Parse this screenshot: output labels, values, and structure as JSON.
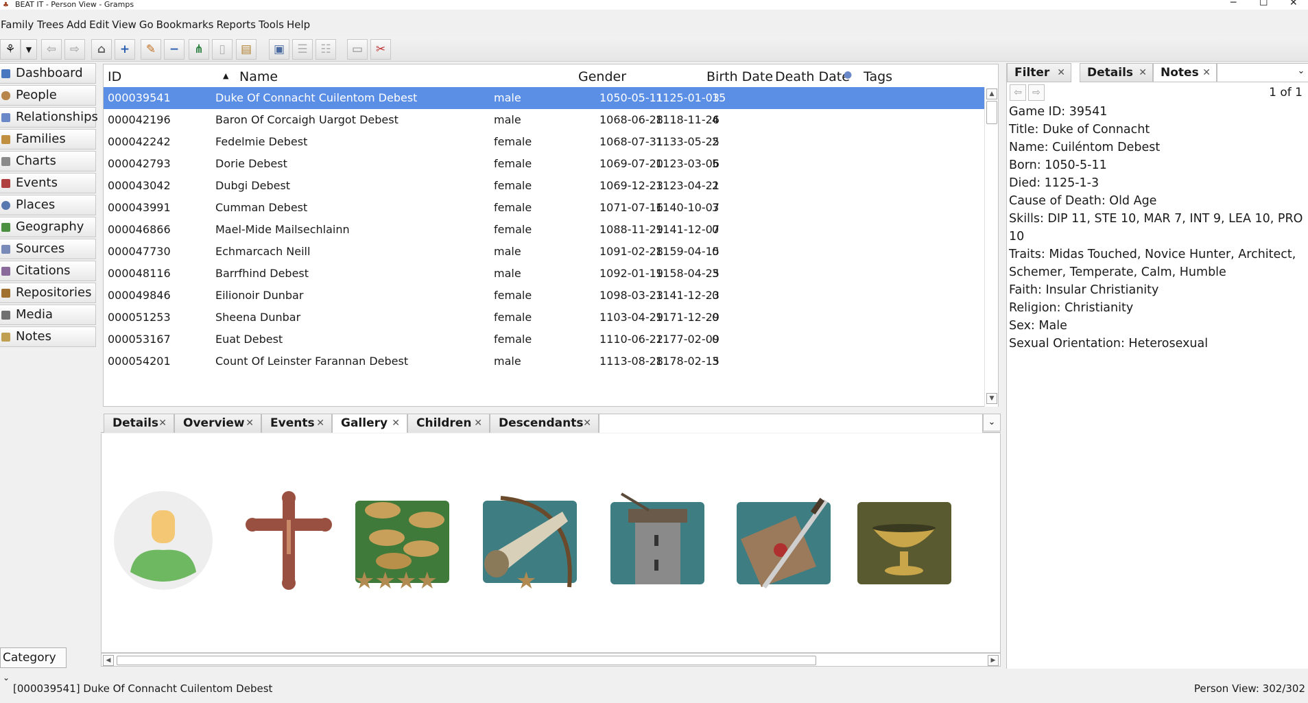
{
  "window": {
    "title": "BEAT IT - Person View - Gramps"
  },
  "menu": [
    "Family Trees",
    "Add",
    "Edit",
    "View",
    "Go",
    "Bookmarks",
    "Reports",
    "Tools",
    "Help"
  ],
  "sidebar": {
    "items": [
      {
        "label": "Dashboard",
        "icon": "dashboard-icon",
        "color": "#4a78c0"
      },
      {
        "label": "People",
        "icon": "people-icon",
        "color": "#b8864a"
      },
      {
        "label": "Relationships",
        "icon": "relationships-icon",
        "color": "#6a88c8"
      },
      {
        "label": "Families",
        "icon": "families-icon",
        "color": "#c09040"
      },
      {
        "label": "Charts",
        "icon": "charts-icon",
        "color": "#8a8a8a"
      },
      {
        "label": "Events",
        "icon": "events-icon",
        "color": "#b04040"
      },
      {
        "label": "Places",
        "icon": "places-icon",
        "color": "#5878b0"
      },
      {
        "label": "Geography",
        "icon": "geography-icon",
        "color": "#4a9040"
      },
      {
        "label": "Sources",
        "icon": "sources-icon",
        "color": "#7a8ab8"
      },
      {
        "label": "Citations",
        "icon": "citations-icon",
        "color": "#8a6a9a"
      },
      {
        "label": "Repositories",
        "icon": "repositories-icon",
        "color": "#a07030"
      },
      {
        "label": "Media",
        "icon": "media-icon",
        "color": "#707070"
      },
      {
        "label": "Notes",
        "icon": "notes-icon",
        "color": "#c0a050"
      }
    ],
    "category_label": "Category"
  },
  "list": {
    "headers": {
      "id": "ID",
      "name": "Name",
      "gender": "Gender",
      "birth": "Birth Date",
      "death": "Death Date",
      "tags": "Tags"
    },
    "rows": [
      {
        "id": "000039541",
        "name": "Duke Of Connacht Cuilentom Debest",
        "gender": "male",
        "birth": "1050-05-11",
        "death": "1125-01-03",
        "count": "15",
        "selected": true
      },
      {
        "id": "000042196",
        "name": "Baron Of Corcaigh Uargot Debest",
        "gender": "male",
        "birth": "1068-06-28",
        "death": "1118-11-26",
        "count": "4"
      },
      {
        "id": "000042242",
        "name": "Fedelmie Debest",
        "gender": "female",
        "birth": "1068-07-31",
        "death": "1133-05-25",
        "count": "2"
      },
      {
        "id": "000042793",
        "name": "Dorie Debest",
        "gender": "female",
        "birth": "1069-07-20",
        "death": "1123-03-06",
        "count": "5"
      },
      {
        "id": "000043042",
        "name": "Dubgi Debest",
        "gender": "female",
        "birth": "1069-12-23",
        "death": "1123-04-21",
        "count": "2"
      },
      {
        "id": "000043991",
        "name": "Cumman Debest",
        "gender": "female",
        "birth": "1071-07-16",
        "death": "1140-10-07",
        "count": "3"
      },
      {
        "id": "000046866",
        "name": "Mael-Mide Mailsechlainn",
        "gender": "female",
        "birth": "1088-11-29",
        "death": "1141-12-07",
        "count": "0"
      },
      {
        "id": "000047730",
        "name": "Echmarcach Neill",
        "gender": "male",
        "birth": "1091-02-28",
        "death": "1159-04-15",
        "count": "0"
      },
      {
        "id": "000048116",
        "name": "Barrfhind Debest",
        "gender": "male",
        "birth": "1092-01-19",
        "death": "1158-04-25",
        "count": "3"
      },
      {
        "id": "000049846",
        "name": "Eilionoir Dunbar",
        "gender": "female",
        "birth": "1098-03-23",
        "death": "1141-12-23",
        "count": "0"
      },
      {
        "id": "000051253",
        "name": "Sheena Dunbar",
        "gender": "female",
        "birth": "1103-04-29",
        "death": "1171-12-29",
        "count": "0"
      },
      {
        "id": "000053167",
        "name": "Euat Debest",
        "gender": "female",
        "birth": "1110-06-22",
        "death": "1177-02-09",
        "count": "0"
      },
      {
        "id": "000054201",
        "name": "Count Of Leinster Farannan Debest",
        "gender": "male",
        "birth": "1113-08-28",
        "death": "1178-02-15",
        "count": "3"
      }
    ]
  },
  "bottom_tabs": [
    "Details",
    "Overview",
    "Events",
    "Gallery",
    "Children",
    "Descendants"
  ],
  "gallery": [
    "person-silhouette",
    "crucifix",
    "gold-coins-four-stars",
    "hunting-horn-bow-one-star",
    "stone-tower",
    "letter-dagger",
    "golden-chalice"
  ],
  "right_panel": {
    "tabs": [
      "Filter",
      "Details",
      "Notes"
    ],
    "pager": "1 of 1",
    "notes": [
      "Game ID: 39541",
      "Title: Duke of Connacht",
      "Name: Cuiléntom Debest",
      "Born: 1050-5-11",
      "Died: 1125-1-3",
      "Cause of Death: Old Age",
      "Skills: DIP 11, STE 10, MAR 7, INT 9, LEA 10, PRO 10",
      "Traits: Midas Touched, Novice Hunter, Architect,",
      "Schemer, Temperate, Calm, Humble",
      "Faith: Insular Christianity",
      "Religion: Christianity",
      "Sex: Male",
      "Sexual Orientation: Heterosexual"
    ]
  },
  "status": {
    "left": "[000039541] Duke Of Connacht Cuilentom Debest",
    "right": "Person View: 302/302"
  },
  "colors": {
    "selection": "#5b8fe6"
  }
}
